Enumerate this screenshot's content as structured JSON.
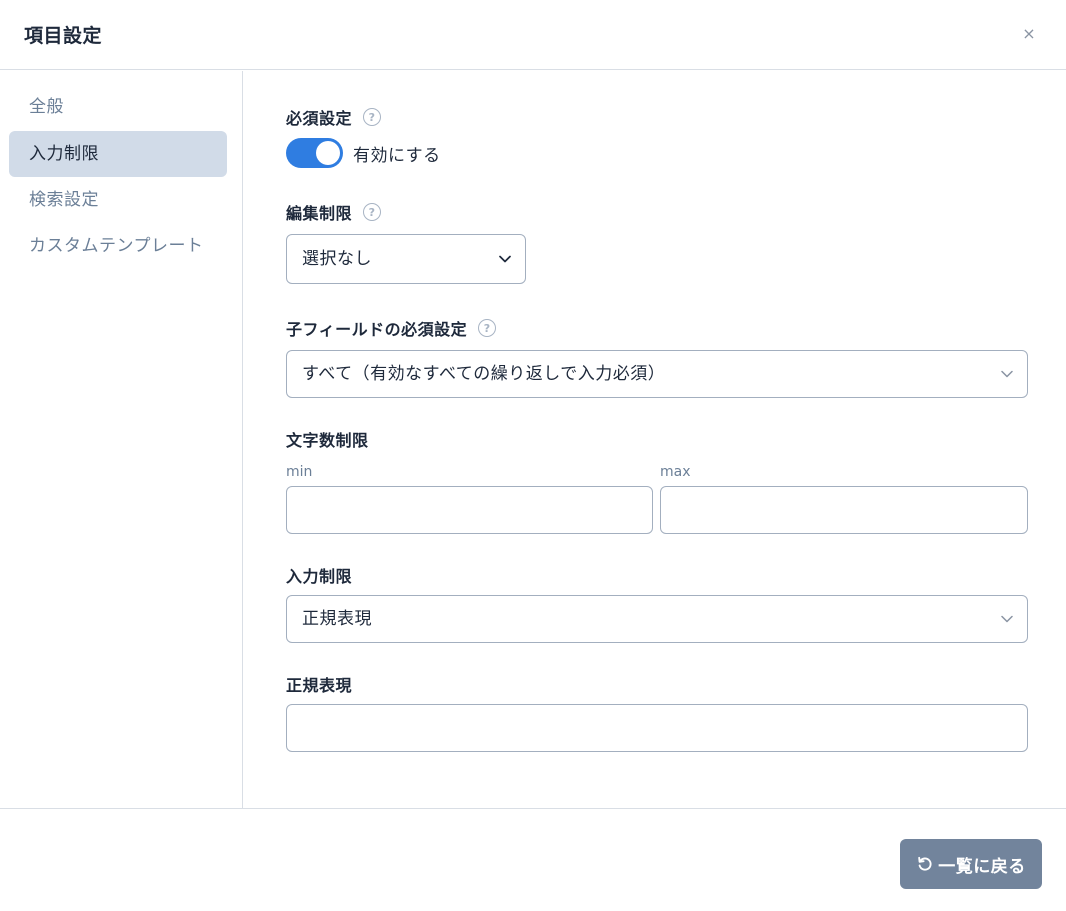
{
  "dialog": {
    "title": "項目設定",
    "close_label": "×"
  },
  "sidebar": {
    "items": [
      {
        "label": "全般"
      },
      {
        "label": "入力制限"
      },
      {
        "label": "検索設定"
      },
      {
        "label": "カスタムテンプレート"
      }
    ],
    "active_index": 1
  },
  "form": {
    "required": {
      "label": "必須設定",
      "toggle_on": true,
      "toggle_text": "有効にする"
    },
    "edit_restriction": {
      "label": "編集制限",
      "selected": "選択なし"
    },
    "child_required": {
      "label": "子フィールドの必須設定",
      "selected": "すべて（有効なすべての繰り返しで入力必須）"
    },
    "char_limit": {
      "label": "文字数制限",
      "min_label": "min",
      "min_value": "",
      "max_label": "max",
      "max_value": ""
    },
    "input_restriction": {
      "label": "入力制限",
      "selected": "正規表現"
    },
    "regex": {
      "label": "正規表現",
      "value": ""
    }
  },
  "footer": {
    "back_label": "一覧に戻る"
  },
  "colors": {
    "accent": "#2f7de1",
    "active_nav": "#d1dbe8",
    "button": "#72849c"
  },
  "icons": {
    "help": "question-circle-icon",
    "chevron": "chevron-down-icon",
    "back": "undo-icon",
    "close": "close-icon"
  }
}
